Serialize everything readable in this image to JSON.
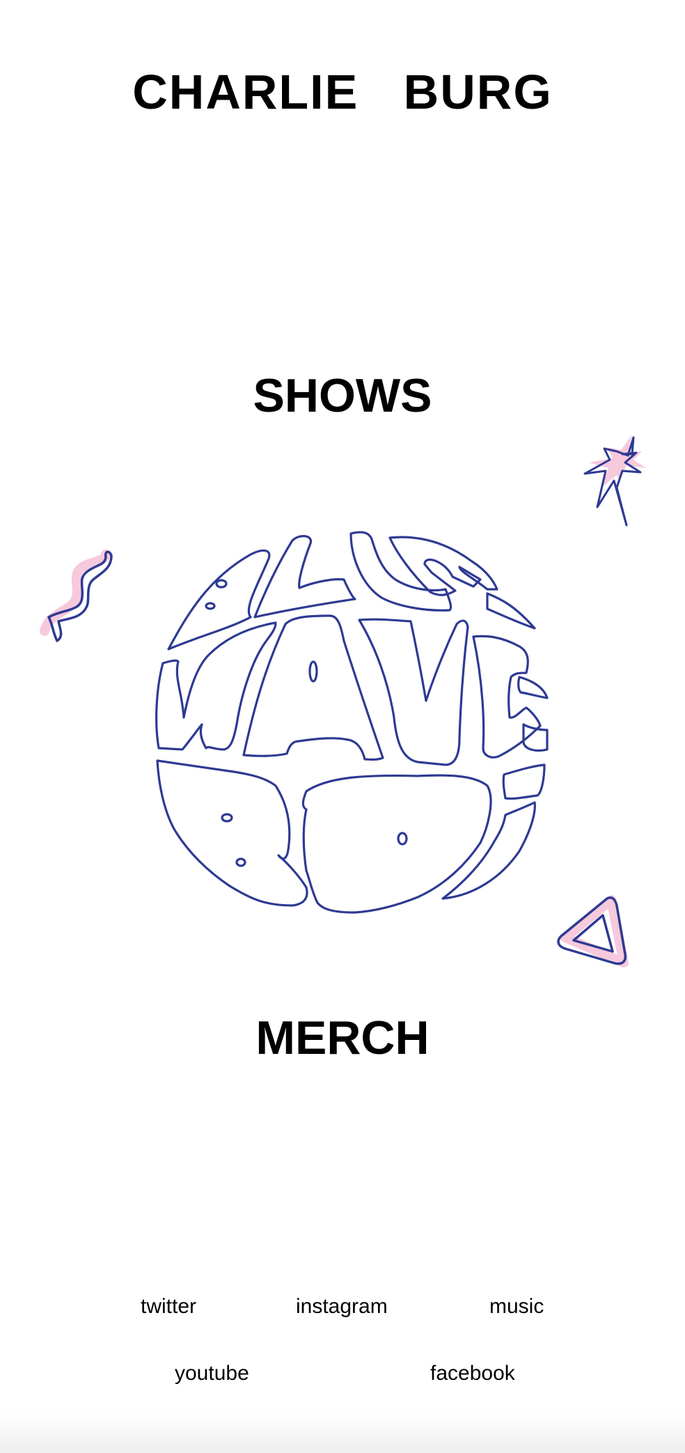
{
  "header": {
    "title": "CHARLIE   BURG"
  },
  "nav": {
    "shows_label": "SHOWS",
    "merch_label": "MERCH"
  },
  "logo": {
    "text": "BLUE WAVE BOI",
    "stroke_color": "#2e3a93",
    "accent_color": "#f6c9dd"
  },
  "decorations": {
    "icons": [
      "squiggle-icon",
      "starburst-icon",
      "triangle-icon"
    ]
  },
  "footer": {
    "links": [
      {
        "label": "twitter"
      },
      {
        "label": "instagram"
      },
      {
        "label": "music"
      },
      {
        "label": "youtube"
      },
      {
        "label": "facebook"
      }
    ]
  }
}
